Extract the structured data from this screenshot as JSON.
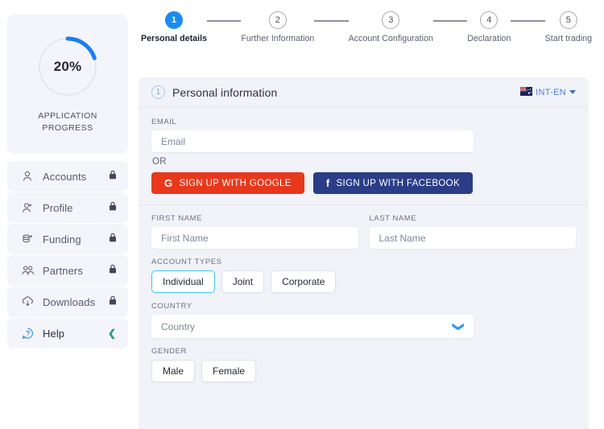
{
  "sidebar": {
    "progress": {
      "percent_label": "20%",
      "percent_value": 20,
      "caption_line1": "APPLICATION",
      "caption_line2": "PROGRESS",
      "arc_color": "#1a7ef0",
      "track_color": "#dfe2ec"
    },
    "items": [
      {
        "label": "Accounts",
        "icon": "user-icon",
        "trailing": "lock-icon"
      },
      {
        "label": "Profile",
        "icon": "user-plus-icon",
        "trailing": "lock-icon"
      },
      {
        "label": "Funding",
        "icon": "coins-plus-icon",
        "trailing": "lock-icon"
      },
      {
        "label": "Partners",
        "icon": "users-icon",
        "trailing": "lock-icon"
      },
      {
        "label": "Downloads",
        "icon": "cloud-download-icon",
        "trailing": "lock-icon"
      },
      {
        "label": "Help",
        "icon": "help-bubble-icon",
        "trailing": "chevron-left-icon"
      }
    ]
  },
  "stepper": {
    "steps": [
      {
        "number": "1",
        "label": "Personal details",
        "active": true
      },
      {
        "number": "2",
        "label": "Further Information",
        "active": false
      },
      {
        "number": "3",
        "label": "Account Configuration",
        "active": false
      },
      {
        "number": "4",
        "label": "Declaration",
        "active": false
      },
      {
        "number": "5",
        "label": "Start trading",
        "active": false
      }
    ]
  },
  "panel": {
    "badge_number": "1",
    "title": "Personal information",
    "language": {
      "code": "INT-EN",
      "flag": "au-flag-icon"
    },
    "email": {
      "label": "EMAIL",
      "placeholder": "Email",
      "value": ""
    },
    "or_label": "OR",
    "social": {
      "google": {
        "label": "SIGN UP WITH GOOGLE",
        "glyph": "G",
        "color": "#e8381c"
      },
      "facebook": {
        "label": "SIGN UP WITH FACEBOOK",
        "glyph": "f",
        "color": "#2b3d86"
      }
    },
    "first_name": {
      "label": "FIRST NAME",
      "placeholder": "First Name",
      "value": ""
    },
    "last_name": {
      "label": "LAST NAME",
      "placeholder": "Last Name",
      "value": ""
    },
    "account_types": {
      "label": "ACCOUNT TYPES",
      "options": [
        {
          "label": "Individual",
          "selected": true
        },
        {
          "label": "Joint",
          "selected": false
        },
        {
          "label": "Corporate",
          "selected": false
        }
      ]
    },
    "country": {
      "label": "COUNTRY",
      "placeholder": "Country",
      "value": "",
      "caret": "chevron-down-icon"
    },
    "gender": {
      "label": "GENDER",
      "options": [
        {
          "label": "Male",
          "selected": false
        },
        {
          "label": "Female",
          "selected": false
        }
      ]
    }
  },
  "colors": {
    "accent_blue": "#1a8bf0",
    "selected_border": "#3ec6ef",
    "panel_bg": "#f2f3f9",
    "card_bg": "#f4f5fa"
  }
}
